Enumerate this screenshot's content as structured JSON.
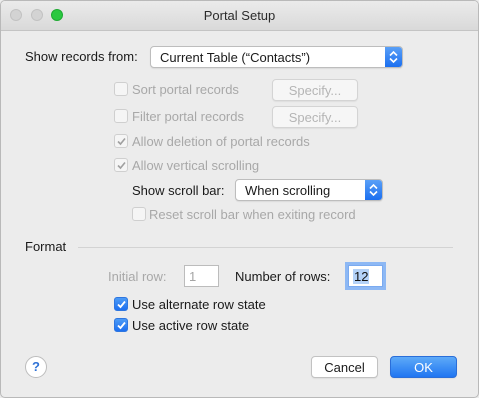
{
  "window": {
    "title": "Portal Setup"
  },
  "show_records": {
    "label": "Show records from:",
    "value": "Current Table (“Contacts”)"
  },
  "options": {
    "sort_label": "Sort portal records",
    "sort_specify": "Specify...",
    "filter_label": "Filter portal records",
    "filter_specify": "Specify...",
    "allow_deletion_label": "Allow deletion of portal records",
    "allow_scrolling_label": "Allow vertical scrolling",
    "scroll_bar_label": "Show scroll bar:",
    "scroll_bar_value": "When scrolling",
    "reset_scroll_label": "Reset scroll bar when exiting record"
  },
  "format": {
    "heading": "Format",
    "initial_row_label": "Initial row:",
    "initial_row_value": "1",
    "num_rows_label": "Number of rows:",
    "num_rows_value": "12",
    "alternate_label": "Use alternate row state",
    "active_label": "Use active row state"
  },
  "buttons": {
    "help": "?",
    "cancel": "Cancel",
    "ok": "OK"
  },
  "colors": {
    "accent": "#1f75f1",
    "zoom_button": "#2ac840"
  }
}
